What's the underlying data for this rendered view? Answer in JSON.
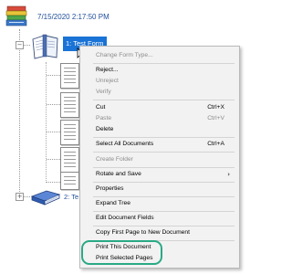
{
  "tree": {
    "root": {
      "label": "7/15/2020 2:17:50 PM",
      "icon": "stacked-trays-icon"
    },
    "selected_node": {
      "label": "1: Test Form",
      "icon": "open-binder-icon"
    },
    "second_node": {
      "label": "2: Te",
      "icon": "closed-binder-icon"
    },
    "expander_symbol": "−",
    "expander_collapsed_symbol": "+",
    "page_count_visible": 5
  },
  "context_menu": {
    "items": [
      {
        "label": "Change Form Type...",
        "enabled": false,
        "shortcut": ""
      },
      {
        "label": "Reject...",
        "enabled": true,
        "shortcut": ""
      },
      {
        "label": "Unreject",
        "enabled": false,
        "shortcut": ""
      },
      {
        "label": "Verify",
        "enabled": false,
        "shortcut": ""
      },
      {
        "label": "Cut",
        "enabled": true,
        "shortcut": "Ctrl+X"
      },
      {
        "label": "Paste",
        "enabled": false,
        "shortcut": "Ctrl+V"
      },
      {
        "label": "Delete",
        "enabled": true,
        "shortcut": ""
      },
      {
        "label": "Select All Documents",
        "enabled": true,
        "shortcut": "Ctrl+A"
      },
      {
        "label": "Create Folder",
        "enabled": false,
        "shortcut": ""
      },
      {
        "label": "Rotate and Save",
        "enabled": true,
        "shortcut": "",
        "submenu_arrow": "›"
      },
      {
        "label": "Properties",
        "enabled": true,
        "shortcut": ""
      },
      {
        "label": "Expand Tree",
        "enabled": true,
        "shortcut": ""
      },
      {
        "label": "Edit Document Fields",
        "enabled": true,
        "shortcut": ""
      },
      {
        "label": "Copy First Page to New Document",
        "enabled": true,
        "shortcut": ""
      },
      {
        "label": "Print This Document",
        "enabled": true,
        "shortcut": ""
      },
      {
        "label": "Print Selected Pages",
        "enabled": true,
        "shortcut": ""
      }
    ]
  },
  "colors": {
    "selection": "#1a73d6",
    "highlight_ring": "#2aa985",
    "node_text": "#1f4e9a",
    "disabled_text": "#8c8c8c",
    "menu_background": "#f2f2f2"
  }
}
